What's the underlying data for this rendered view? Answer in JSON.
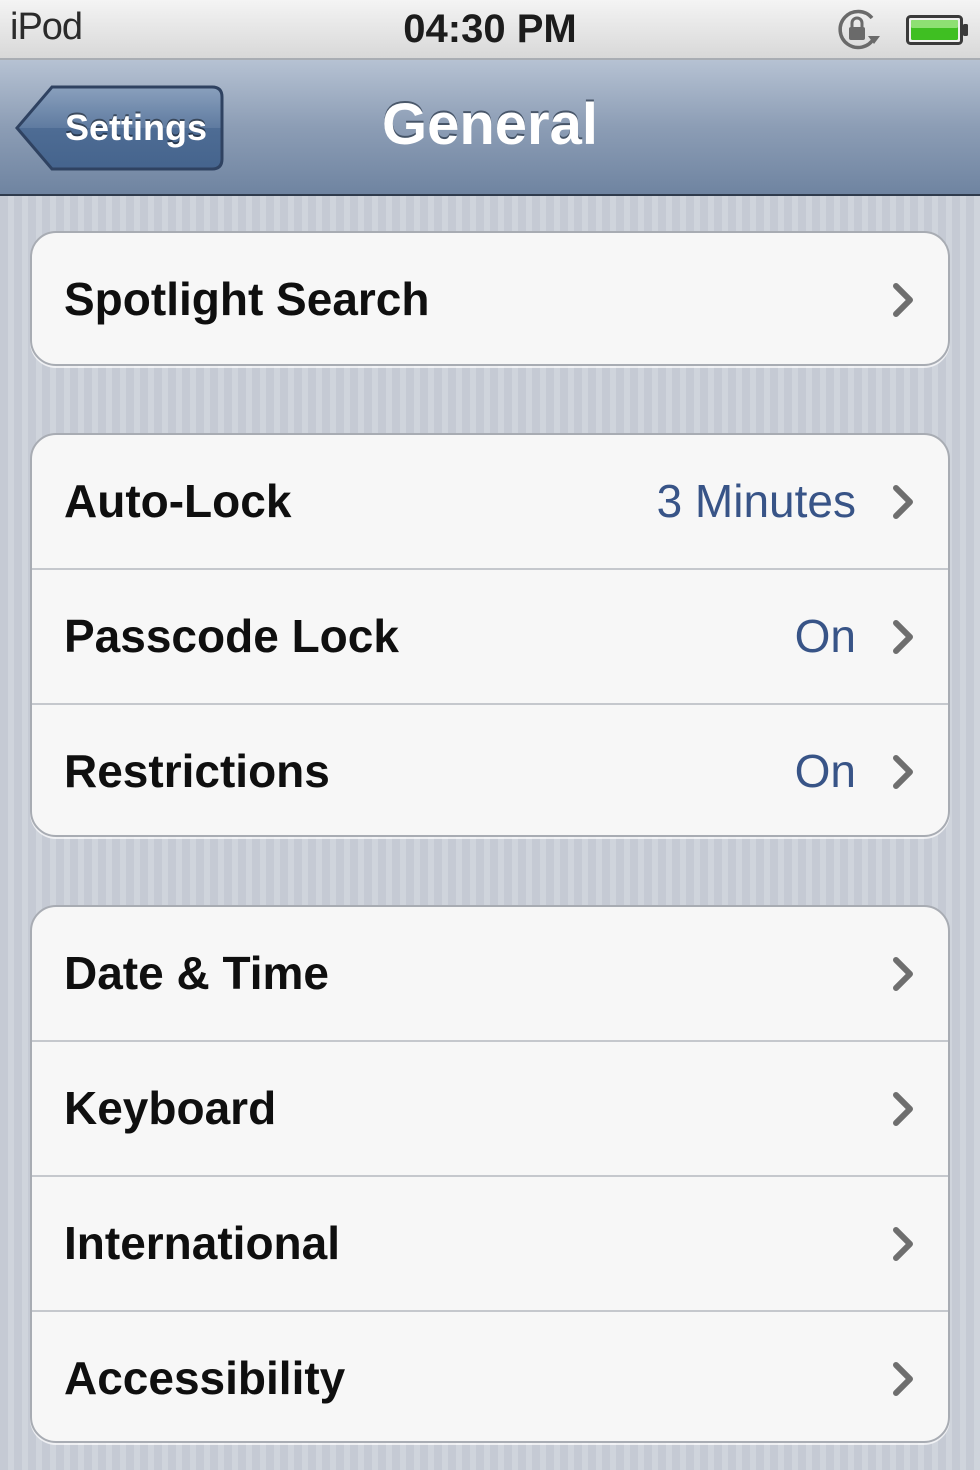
{
  "status_bar": {
    "carrier": "iPod",
    "time": "04:30 PM",
    "icons": [
      "rotation-lock-icon",
      "battery-icon"
    ],
    "battery_color": "#3fbf22"
  },
  "nav_bar": {
    "back_label": "Settings",
    "title": "General"
  },
  "groups": [
    {
      "items": [
        {
          "label": "Spotlight Search",
          "value": ""
        }
      ]
    },
    {
      "items": [
        {
          "label": "Auto-Lock",
          "value": "3 Minutes"
        },
        {
          "label": "Passcode Lock",
          "value": "On"
        },
        {
          "label": "Restrictions",
          "value": "On"
        }
      ]
    },
    {
      "items": [
        {
          "label": "Date & Time",
          "value": ""
        },
        {
          "label": "Keyboard",
          "value": ""
        },
        {
          "label": "International",
          "value": ""
        },
        {
          "label": "Accessibility",
          "value": ""
        }
      ]
    }
  ],
  "colors": {
    "value_text": "#385487",
    "nav_bar": "#8c9db5"
  }
}
